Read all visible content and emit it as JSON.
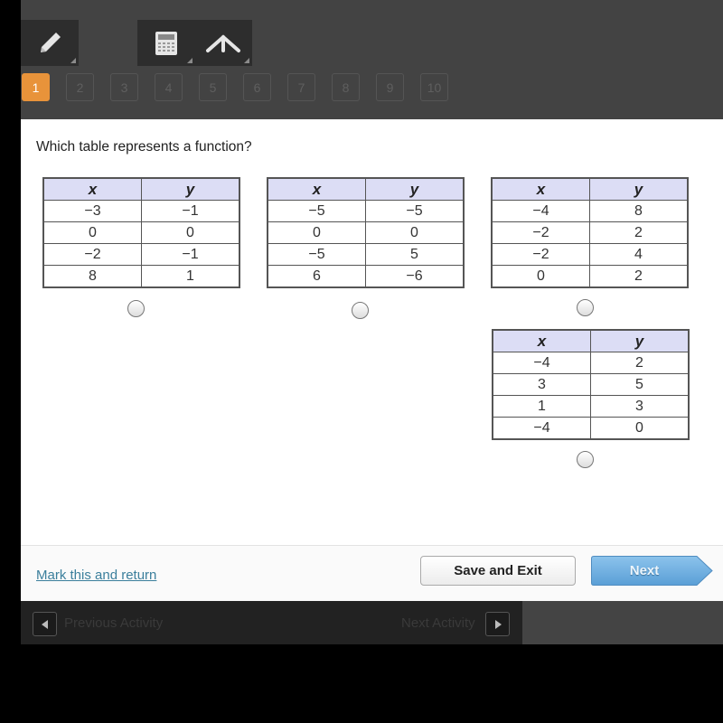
{
  "toolbar": {
    "tools": [
      {
        "name": "pencil",
        "icon": "pencil-icon"
      },
      {
        "name": "calculator",
        "icon": "calculator-icon"
      },
      {
        "name": "reference",
        "icon": "reference-icon"
      }
    ]
  },
  "question_nav": {
    "current": 1,
    "items": [
      "1",
      "2",
      "3",
      "4",
      "5",
      "6",
      "7",
      "8",
      "9",
      "10"
    ],
    "active_color": "#E8933A"
  },
  "question": {
    "text": "Which table represents a function?",
    "tables": [
      {
        "headers": [
          "x",
          "y"
        ],
        "rows": [
          [
            "−3",
            "−1"
          ],
          [
            "0",
            "0"
          ],
          [
            "−2",
            "−1"
          ],
          [
            "8",
            "1"
          ]
        ]
      },
      {
        "headers": [
          "x",
          "y"
        ],
        "rows": [
          [
            "−5",
            "−5"
          ],
          [
            "0",
            "0"
          ],
          [
            "−5",
            "5"
          ],
          [
            "6",
            "−6"
          ]
        ]
      },
      {
        "headers": [
          "x",
          "y"
        ],
        "rows": [
          [
            "−4",
            "8"
          ],
          [
            "−2",
            "2"
          ],
          [
            "−2",
            "4"
          ],
          [
            "0",
            "2"
          ]
        ]
      },
      {
        "headers": [
          "x",
          "y"
        ],
        "rows": [
          [
            "−4",
            "2"
          ],
          [
            "3",
            "5"
          ],
          [
            "1",
            "3"
          ],
          [
            "−4",
            "0"
          ]
        ]
      }
    ]
  },
  "actions": {
    "mark_label": "Mark this and return",
    "save_label": "Save and Exit",
    "next_label": "Next"
  },
  "footer": {
    "prev_activity": "Previous Activity",
    "next_activity": "Next Activity"
  }
}
